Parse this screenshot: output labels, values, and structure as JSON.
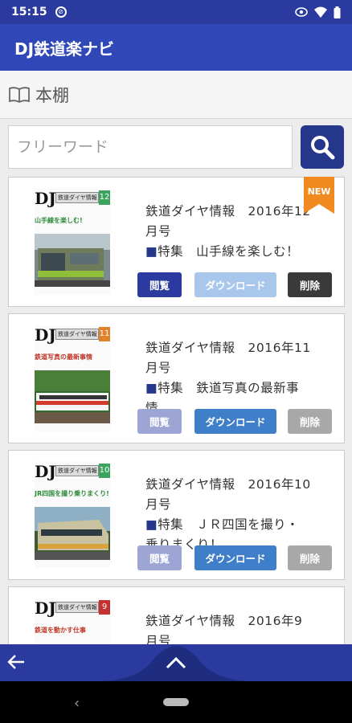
{
  "status": {
    "time": "15:15"
  },
  "app": {
    "title": "DJ鉄道楽ナビ"
  },
  "section": {
    "title": "本棚"
  },
  "search": {
    "placeholder": "フリーワード"
  },
  "buttons": {
    "view": "閲覧",
    "download": "ダウンロード",
    "delete": "削除"
  },
  "colors": {
    "appbar": "#2f47b7",
    "view_active": "#2b3a9e",
    "download_active": "#3f7ec9",
    "delete_active": "#3a3a3a"
  },
  "books": [
    {
      "title_line1": "鉄道ダイヤ情報　2016年12",
      "title_line2": "月号",
      "title_line3": "特集　山手線を楽しむ！",
      "title_line4": "",
      "is_new": true,
      "new_label": "NEW",
      "issue": "12",
      "cover_headline": "山手線を楽しむ!",
      "state": "downloaded"
    },
    {
      "title_line1": "鉄道ダイヤ情報　2016年11",
      "title_line2": "月号",
      "title_line3": "特集　鉄道写真の最新事",
      "title_line4": "情",
      "is_new": false,
      "issue": "11",
      "cover_headline": "鉄道写真の最新事情",
      "state": "not_downloaded"
    },
    {
      "title_line1": "鉄道ダイヤ情報　2016年10",
      "title_line2": "月号",
      "title_line3": "特集　ＪＲ四国を撮り・",
      "title_line4": "乗りまくり！",
      "is_new": false,
      "issue": "10",
      "cover_headline": "JR四国を撮り乗りまくり!",
      "state": "not_downloaded"
    },
    {
      "title_line1": "鉄道ダイヤ情報　2016年9",
      "title_line2": "月号",
      "title_line3": "",
      "title_line4": "",
      "is_new": false,
      "issue": "9",
      "cover_headline": "鉄道を動かす仕事",
      "state": "not_downloaded"
    }
  ],
  "icons": {
    "book": "book-open-icon",
    "search": "search-icon",
    "back": "arrow-left-icon",
    "up": "chevron-up-icon",
    "new": "new-ribbon-icon"
  }
}
